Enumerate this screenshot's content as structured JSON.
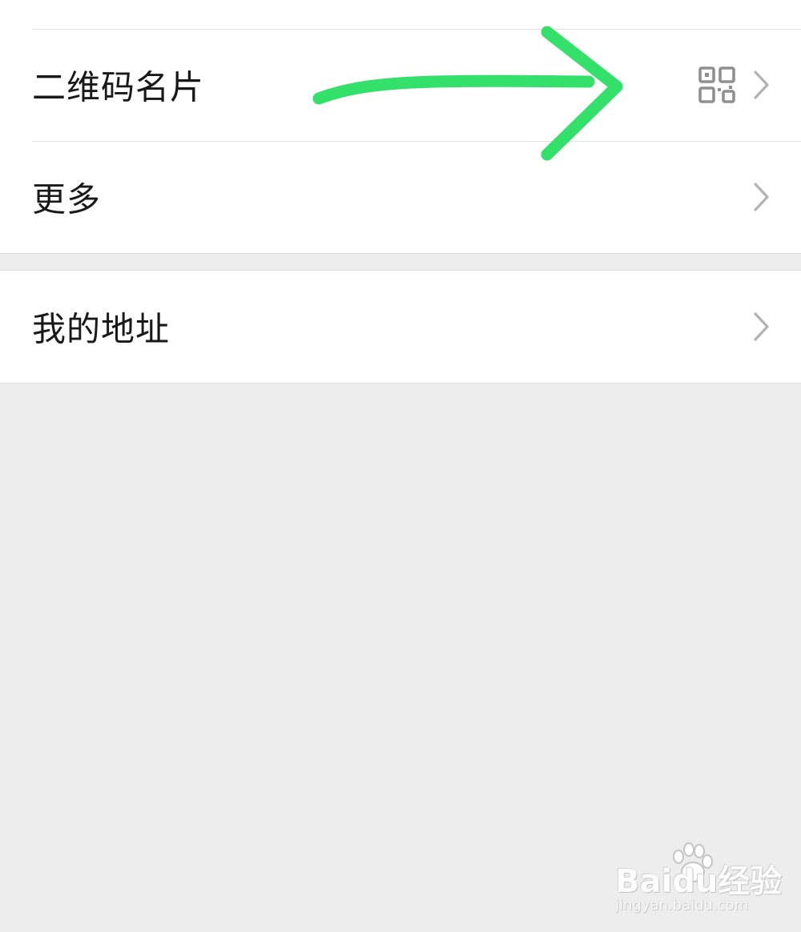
{
  "menu": {
    "items": [
      {
        "label": "二维码名片",
        "trailing_icon": "qr-code-icon"
      },
      {
        "label": "更多"
      }
    ],
    "address": {
      "label": "我的地址"
    }
  },
  "annotation": {
    "arrow_color": "#33e06a",
    "icon": "arrow-right-icon"
  },
  "watermark": {
    "logo": "Baidu经验",
    "url": "jingyan.baidu.com"
  },
  "colors": {
    "background": "#ededed",
    "card": "#ffffff",
    "text": "#191919",
    "chevron": "#b2b2b2",
    "annotation": "#33e06a"
  }
}
